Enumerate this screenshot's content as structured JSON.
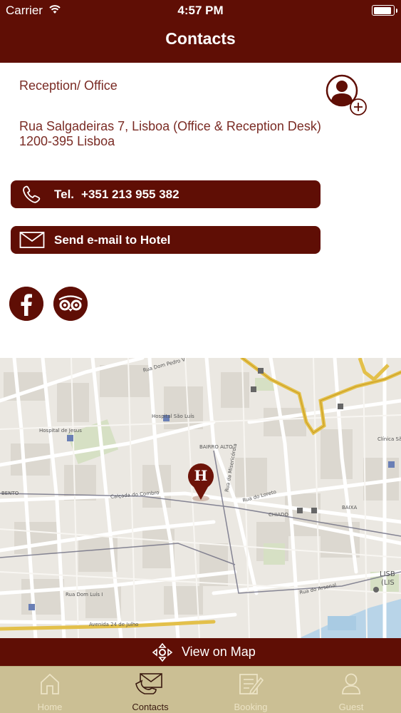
{
  "status_bar": {
    "carrier": "Carrier",
    "time": "4:57 PM",
    "battery_level": 0.92
  },
  "header": {
    "title": "Contacts"
  },
  "contact": {
    "section_label": "Reception/ Office",
    "address_line1": "Rua Salgadeiras 7, Lisboa (Office & Reception Desk)",
    "address_line2": "1200-395 Lisboa",
    "phone_label": "Tel.",
    "phone_number": "+351 213 955 382",
    "email_label": "Send e-mail to Hotel"
  },
  "social": {
    "icons": [
      "facebook-icon",
      "tripadvisor-icon"
    ]
  },
  "map": {
    "pin_letter": "H",
    "labels": {
      "hospital_sao_luis": "Hospital São Luís",
      "hospital_de_jesus": "Hospital de Jesus",
      "bairro_alto": "BAIRRO ALTO",
      "chiado": "CHIADO",
      "baixa": "BAIXA",
      "bento": "BENTO",
      "lisboa": "LISB",
      "lisboa2": "(LIS",
      "clinica": "Clínica São Cris",
      "av_24_julho": "Avenida 24 de Julho",
      "rua_arsenal": "Rua do Arsenal",
      "rua_dom_luis": "Rua Dom Luís I",
      "rua_pedro_v": "Rua Dom Pedro V",
      "rua_misericordia": "Rua da Misericórdia",
      "calcada_combro": "Calçada do Combro",
      "rua_loreto": "Rua do Loreto"
    }
  },
  "map_bar": {
    "label": "View on Map"
  },
  "tabs": [
    {
      "label": "Home",
      "icon": "home-icon",
      "active": false
    },
    {
      "label": "Contacts",
      "icon": "contacts-icon",
      "active": true
    },
    {
      "label": "Booking",
      "icon": "booking-icon",
      "active": false
    },
    {
      "label": "Guest",
      "icon": "guest-icon",
      "active": false
    }
  ],
  "colors": {
    "brand": "#5f0e05",
    "tabbar": "#cbbf94",
    "tab_inactive": "#ece3c5",
    "tab_active": "#3a1a10"
  }
}
